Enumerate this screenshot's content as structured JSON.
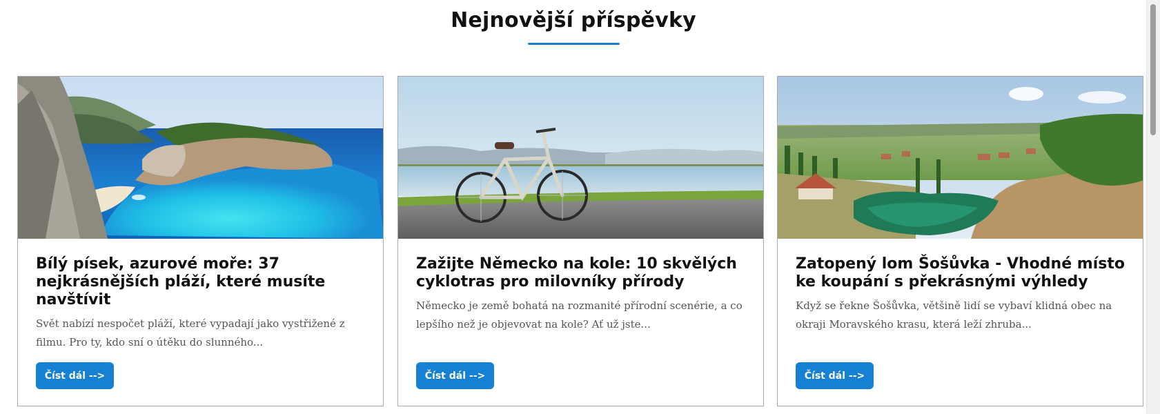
{
  "section": {
    "title": "Nejnovější příspěvky",
    "accent_color": "#1a7fd4"
  },
  "posts": [
    {
      "title": "Bílý písek, azurové moře: 37 nejkrásnějších pláží, které musíte navštívit",
      "excerpt": "Svět nabízí nespočet pláží, které vypadají jako vystřižené z filmu. Pro ty, kdo sní o útěku do slunného...",
      "button_label": "Číst dál -->",
      "image": "beach-cove-photo"
    },
    {
      "title": "Zažijte Německo na kole: 10 skvělých cyklotras pro milovníky přírody",
      "excerpt": "Německo je země bohatá na rozmanité přírodní scenérie, a co lepšího než je objevovat na kole? Ať už jste...",
      "button_label": "Číst dál -->",
      "image": "bicycle-lake-photo"
    },
    {
      "title": "Zatopený lom Šošůvka - Vhodné místo ke koupání s překrásnými výhledy",
      "excerpt": "Když se řekne Šošůvka, většině lidí se vybaví klidná obec na okraji Moravského krasu, která leží zhruba...",
      "button_label": "Číst dál -->",
      "image": "flooded-quarry-photo"
    }
  ],
  "button_color": "#1680d3"
}
